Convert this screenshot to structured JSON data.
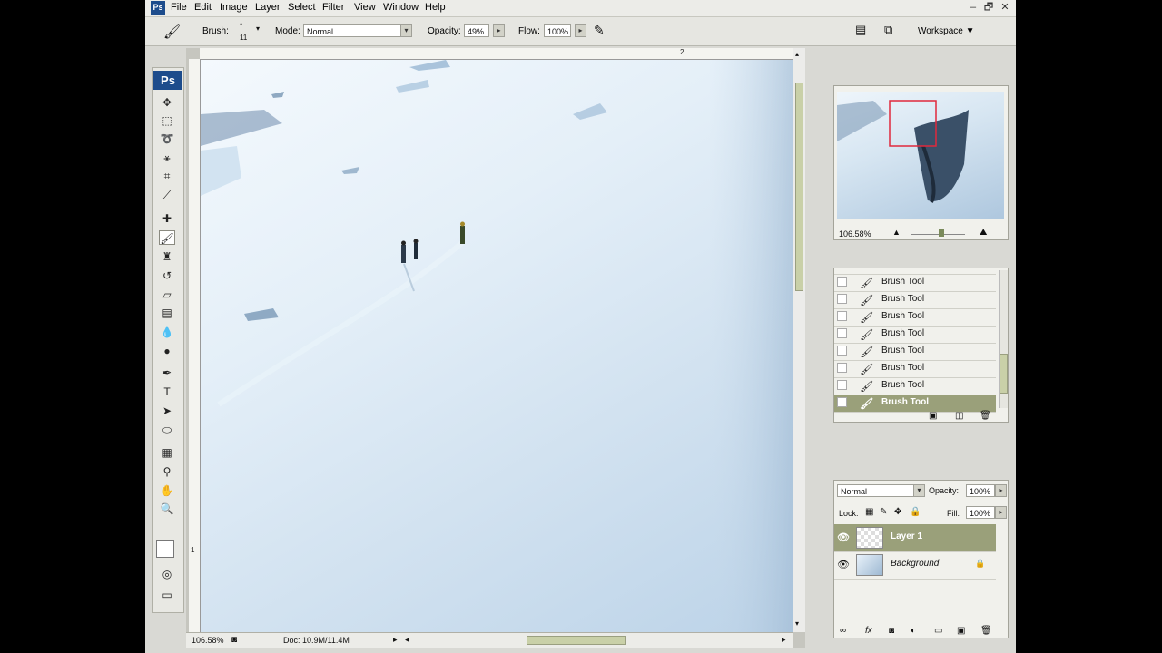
{
  "menu": {
    "app_icon": "Ps",
    "items": [
      "File",
      "Edit",
      "Image",
      "Layer",
      "Select",
      "Filter",
      "View",
      "Window",
      "Help"
    ],
    "window_controls": [
      "–",
      "🗗",
      "✕"
    ]
  },
  "options_bar": {
    "brush_label": "Brush:",
    "brush_size": "11",
    "mode_label": "Mode:",
    "mode_value": "Normal",
    "opacity_label": "Opacity:",
    "opacity_value": "49%",
    "flow_label": "Flow:",
    "flow_value": "100%",
    "workspace_label": "Workspace ▼"
  },
  "toolbox": {
    "logo": "Ps",
    "icons": [
      "move-icon",
      "marquee-icon",
      "lasso-icon",
      "magic-wand-icon",
      "crop-icon",
      "slice-icon",
      "healing-brush-icon",
      "brush-icon",
      "clone-stamp-icon",
      "history-brush-icon",
      "eraser-icon",
      "gradient-icon",
      "blur-icon",
      "dodge-icon",
      "pen-icon",
      "type-icon",
      "path-selection-icon",
      "shape-icon",
      "notes-icon",
      "eyedropper-icon",
      "hand-icon",
      "zoom-icon",
      "color-swatch-icon",
      "quick-mask-icon",
      "screen-mode-icon"
    ]
  },
  "document": {
    "ruler_top_marks": [
      "2"
    ],
    "ruler_left_marks": [
      "1"
    ],
    "zoom": "106.58%",
    "doc_info": "Doc: 10.9M/11.4M"
  },
  "navigator": {
    "zoom": "106.58%"
  },
  "history": {
    "items": [
      {
        "label": "Brush Tool",
        "active": false
      },
      {
        "label": "Brush Tool",
        "active": false
      },
      {
        "label": "Brush Tool",
        "active": false
      },
      {
        "label": "Brush Tool",
        "active": false
      },
      {
        "label": "Brush Tool",
        "active": false
      },
      {
        "label": "Brush Tool",
        "active": false
      },
      {
        "label": "Brush Tool",
        "active": false
      },
      {
        "label": "Brush Tool",
        "active": true
      }
    ]
  },
  "layers": {
    "blend_mode": "Normal",
    "opacity_label": "Opacity:",
    "opacity_value": "100%",
    "lock_label": "Lock:",
    "fill_label": "Fill:",
    "fill_value": "100%",
    "items": [
      {
        "name": "Layer 1",
        "active": true
      },
      {
        "name": "Background",
        "active": false
      }
    ]
  }
}
